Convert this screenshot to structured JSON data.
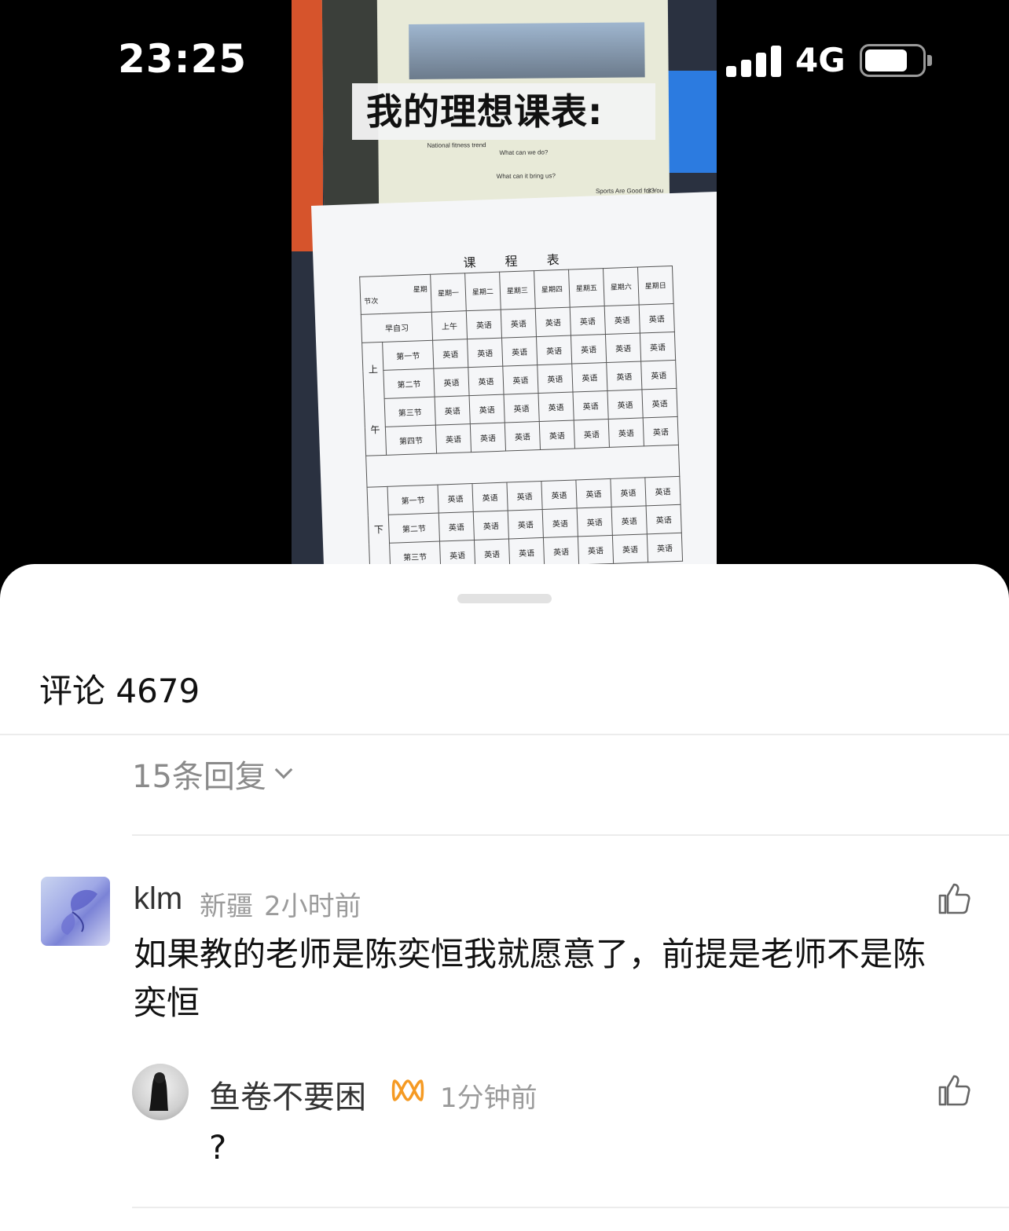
{
  "status_bar": {
    "time": "23:25",
    "network": "4G",
    "battery_level": 0.75
  },
  "video": {
    "overlay_title": "我的理想课表:",
    "book_text": {
      "fitness": "National fitness trend",
      "question1": "What can we do?",
      "question2": "What can it bring us?",
      "footer": "Sports Are Good for You",
      "page": "33"
    },
    "schedule": {
      "title": "课 程 表",
      "corner_top": "星期",
      "corner_bottom": "节次",
      "days": [
        "星期一",
        "星期二",
        "星期三",
        "星期四",
        "星期五",
        "星期六",
        "星期日"
      ],
      "morning_read": {
        "label": "早自习",
        "cells": [
          "上午",
          "英语",
          "英语",
          "英语",
          "英语",
          "英语",
          "英语"
        ]
      },
      "morning_label_top": "上",
      "morning_label_bottom": "午",
      "morning": [
        {
          "label": "第一节",
          "cells": [
            "英语",
            "英语",
            "英语",
            "英语",
            "英语",
            "英语",
            "英语"
          ]
        },
        {
          "label": "第二节",
          "cells": [
            "英语",
            "英语",
            "英语",
            "英语",
            "英语",
            "英语",
            "英语"
          ]
        },
        {
          "label": "第三节",
          "cells": [
            "英语",
            "英语",
            "英语",
            "英语",
            "英语",
            "英语",
            "英语"
          ]
        },
        {
          "label": "第四节",
          "cells": [
            "英语",
            "英语",
            "英语",
            "英语",
            "英语",
            "英语",
            "英语"
          ]
        }
      ],
      "afternoon_label": "下",
      "afternoon": [
        {
          "label": "第一节",
          "cells": [
            "英语",
            "英语",
            "英语",
            "英语",
            "英语",
            "英语",
            "英语"
          ]
        },
        {
          "label": "第二节",
          "cells": [
            "英语",
            "英语",
            "英语",
            "英语",
            "英语",
            "英语",
            "英语"
          ]
        },
        {
          "label": "第三节",
          "cells": [
            "英语",
            "英语",
            "英语",
            "英语",
            "英语",
            "英语",
            "英语"
          ]
        }
      ]
    }
  },
  "comments": {
    "title": "评论 4679",
    "replies_toggle": "15条回复",
    "items": [
      {
        "user": "klm",
        "location": "新疆",
        "time": "2小时前",
        "text": "如果教的老师是陈奕恒我就愿意了，前提是老师不是陈奕恒",
        "like_icon": "thumbs-up-icon"
      },
      {
        "user": "鱼卷不要困",
        "badge_icon": "infinity-badge-icon",
        "badge_color": "#f59a23",
        "time": "1分钟前",
        "text": "?",
        "like_icon": "thumbs-up-icon"
      }
    ]
  }
}
